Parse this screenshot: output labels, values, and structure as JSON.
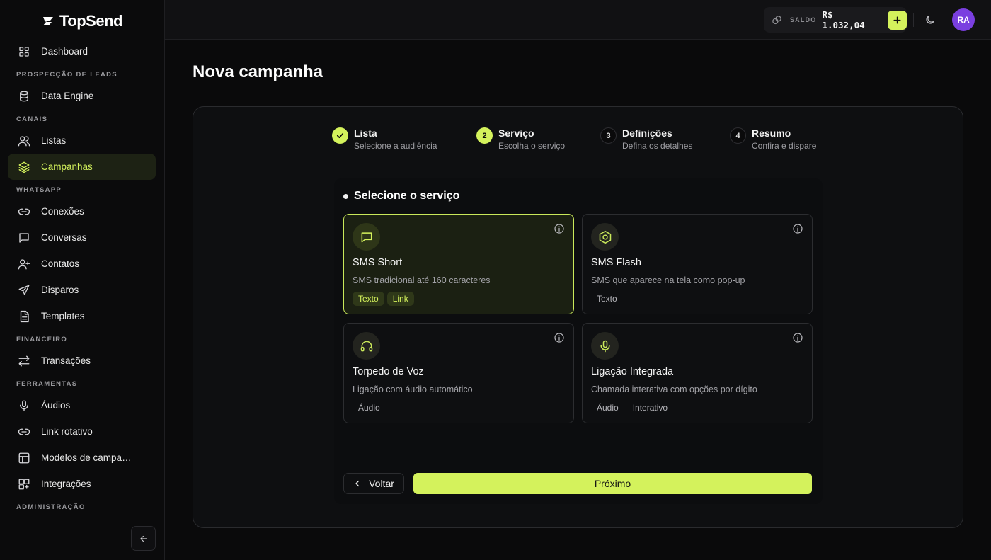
{
  "brand": {
    "name": "TopSend",
    "accent": "#d4f25c"
  },
  "sidebar": {
    "items": [
      {
        "type": "item",
        "label": "Dashboard",
        "icon": "grid-icon"
      },
      {
        "type": "section",
        "label": "PROSPECÇÃO DE LEADS"
      },
      {
        "type": "item",
        "label": "Data Engine",
        "icon": "database-icon"
      },
      {
        "type": "section",
        "label": "CANAIS"
      },
      {
        "type": "item",
        "label": "Listas",
        "icon": "users-icon"
      },
      {
        "type": "item",
        "label": "Campanhas",
        "icon": "layers-icon",
        "active": true
      },
      {
        "type": "section",
        "label": "WHATSAPP"
      },
      {
        "type": "item",
        "label": "Conexões",
        "icon": "link-icon"
      },
      {
        "type": "item",
        "label": "Conversas",
        "icon": "message-icon"
      },
      {
        "type": "item",
        "label": "Contatos",
        "icon": "user-plus-icon"
      },
      {
        "type": "item",
        "label": "Disparos",
        "icon": "send-icon"
      },
      {
        "type": "item",
        "label": "Templates",
        "icon": "file-icon"
      },
      {
        "type": "section",
        "label": "FINANCEIRO"
      },
      {
        "type": "item",
        "label": "Transações",
        "icon": "arrows-icon"
      },
      {
        "type": "section",
        "label": "FERRAMENTAS"
      },
      {
        "type": "item",
        "label": "Áudios",
        "icon": "mic-icon"
      },
      {
        "type": "item",
        "label": "Link rotativo",
        "icon": "link-icon"
      },
      {
        "type": "item",
        "label": "Modelos de campanha",
        "icon": "template-icon"
      },
      {
        "type": "item",
        "label": "Integrações",
        "icon": "puzzle-icon"
      },
      {
        "type": "section",
        "label": "ADMINISTRAÇÃO"
      }
    ]
  },
  "topbar": {
    "balance_label": "SALDO",
    "balance_value": "R$ 1.032,04",
    "avatar_initials": "RA"
  },
  "page": {
    "title": "Nova campanha"
  },
  "steps": [
    {
      "number": "1",
      "title": "Lista",
      "subtitle": "Selecione a audiência",
      "status": "done"
    },
    {
      "number": "2",
      "title": "Serviço",
      "subtitle": "Escolha o serviço",
      "status": "current"
    },
    {
      "number": "3",
      "title": "Definições",
      "subtitle": "Defina os detalhes",
      "status": "pending"
    },
    {
      "number": "4",
      "title": "Resumo",
      "subtitle": "Confira e dispare",
      "status": "pending"
    }
  ],
  "service_panel": {
    "title": "Selecione o serviço",
    "services": [
      {
        "name": "SMS Short",
        "description": "SMS tradicional até 160 caracteres",
        "tags": [
          "Texto",
          "Link"
        ],
        "icon": "message-square-icon",
        "selected": true
      },
      {
        "name": "SMS Flash",
        "description": "SMS que aparece na tela como pop-up",
        "tags": [
          "Texto"
        ],
        "icon": "hexagon-icon",
        "selected": false
      },
      {
        "name": "Torpedo de Voz",
        "description": "Ligação com áudio automático",
        "tags": [
          "Áudio"
        ],
        "icon": "headphones-icon",
        "selected": false
      },
      {
        "name": "Ligação Integrada",
        "description": "Chamada interativa com opções por dígito",
        "tags": [
          "Áudio",
          "Interativo"
        ],
        "icon": "mic-icon",
        "selected": false
      }
    ]
  },
  "actions": {
    "back_label": "Voltar",
    "next_label": "Próximo"
  }
}
